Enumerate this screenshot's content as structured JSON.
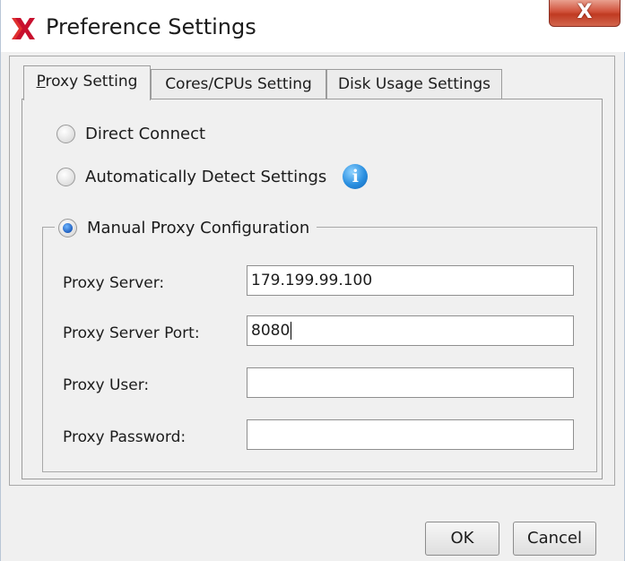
{
  "window": {
    "title": "Preference Settings",
    "close_glyph": "X"
  },
  "tabs": [
    {
      "label": "Proxy Setting",
      "mnemonic": "P",
      "rest": "roxy Setting",
      "active": true
    },
    {
      "label": "Cores/CPUs Setting",
      "active": false
    },
    {
      "label": "Disk Usage Settings",
      "active": false
    }
  ],
  "proxy": {
    "options": {
      "direct": "Direct Connect",
      "auto": "Automatically Detect Settings",
      "manual": "Manual Proxy Configuration"
    },
    "selected": "manual",
    "info_icon": "info-icon",
    "fields": {
      "server_label": "Proxy Server:",
      "server_value": "179.199.99.100",
      "port_label": "Proxy Server Port:",
      "port_value": "8080",
      "user_label": "Proxy User:",
      "user_value": "",
      "password_label": "Proxy Password:",
      "password_value": ""
    }
  },
  "buttons": {
    "ok": "OK",
    "cancel": "Cancel"
  },
  "colors": {
    "close_button": "#c8452c",
    "radio_selected": "#1f5fbf",
    "info_icon": "#2a8fe0",
    "logo": "#c8102e"
  }
}
